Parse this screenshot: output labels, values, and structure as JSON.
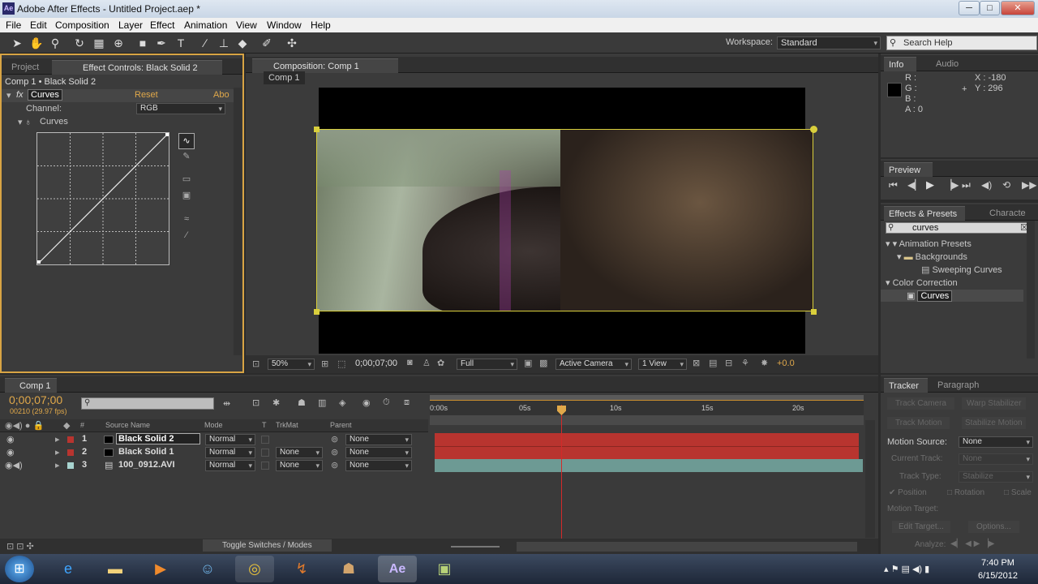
{
  "window": {
    "title": "Adobe After Effects - Untitled Project.aep *",
    "app_icon": "Ae"
  },
  "menu": [
    "File",
    "Edit",
    "Composition",
    "Layer",
    "Effect",
    "Animation",
    "View",
    "Window",
    "Help"
  ],
  "toolbar": {
    "workspace_label": "Workspace:",
    "workspace_value": "Standard",
    "search_placeholder": "Search Help"
  },
  "left_panel": {
    "tabs": [
      "Project",
      "Effect Controls: Black Solid 2"
    ],
    "breadcrumb": "Comp 1 • Black Solid 2",
    "effect_name": "Curves",
    "reset": "Reset",
    "about": "Abo",
    "channel_label": "Channel:",
    "channel_value": "RGB",
    "curves_label": "Curves"
  },
  "comp_panel": {
    "tab": "Composition: Comp 1",
    "subtab": "Comp 1",
    "zoom": "50%",
    "timecode": "0;00;07;00",
    "resolution": "Full",
    "camera": "Active Camera",
    "views": "1 View",
    "exposure": "+0.0"
  },
  "info_panel": {
    "tabs": [
      "Info",
      "Audio"
    ],
    "r": "R :",
    "g": "G :",
    "b": "B :",
    "a": "A : 0",
    "x": "X : -180",
    "y": "Y : 296"
  },
  "preview_panel": {
    "tab": "Preview"
  },
  "effects_panel": {
    "tabs": [
      "Effects & Presets",
      "Characte"
    ],
    "search": "curves",
    "tree": [
      {
        "label": "Animation Presets",
        "level": 0,
        "icon": "triangle"
      },
      {
        "label": "Backgrounds",
        "level": 1,
        "icon": "folder"
      },
      {
        "label": "Sweeping Curves",
        "level": 2,
        "icon": "preset"
      },
      {
        "label": "Color Correction",
        "level": 0,
        "icon": "triangle"
      },
      {
        "label": "Curves",
        "level": 1,
        "icon": "effect"
      }
    ]
  },
  "timeline": {
    "tab": "Comp 1",
    "timecode": "0;00;07;00",
    "fps": "00210 (29.97 fps)",
    "headers": {
      "num": "#",
      "source": "Source Name",
      "mode": "Mode",
      "t": "T",
      "trkmat": "TrkMat",
      "parent": "Parent"
    },
    "ruler": [
      "0:00s",
      "05s",
      "10s",
      "15s",
      "20s"
    ],
    "layers": [
      {
        "num": "1",
        "name": "Black Solid 2",
        "mode": "Normal",
        "trkmat": "",
        "parent": "None",
        "color": "#b8342f"
      },
      {
        "num": "2",
        "name": "Black Solid 1",
        "mode": "Normal",
        "trkmat": "None",
        "parent": "None",
        "color": "#b8342f"
      },
      {
        "num": "3",
        "name": "100_0912.AVI",
        "mode": "Normal",
        "trkmat": "None",
        "parent": "None",
        "color": "#6d9a94"
      }
    ],
    "toggle": "Toggle Switches / Modes"
  },
  "tracker": {
    "tabs": [
      "Tracker",
      "Paragraph"
    ],
    "track_camera": "Track Camera",
    "warp": "Warp Stabilizer",
    "track_motion": "Track Motion",
    "stabilize": "Stabilize Motion",
    "motion_source_label": "Motion Source:",
    "motion_source": "None",
    "current_track_label": "Current Track:",
    "current_track": "None",
    "track_type_label": "Track Type:",
    "track_type": "Stabilize",
    "position": "Position",
    "rotation": "Rotation",
    "scale": "Scale",
    "motion_target": "Motion Target:",
    "edit_target": "Edit Target...",
    "options": "Options...",
    "analyze": "Analyze:"
  },
  "taskbar": {
    "time": "7:40 PM",
    "date": "6/15/2012"
  },
  "colors": {
    "accent": "#e0a84a",
    "layer_red": "#b8342f",
    "layer_teal": "#6d9a94",
    "playhead": "#d22a2a"
  }
}
